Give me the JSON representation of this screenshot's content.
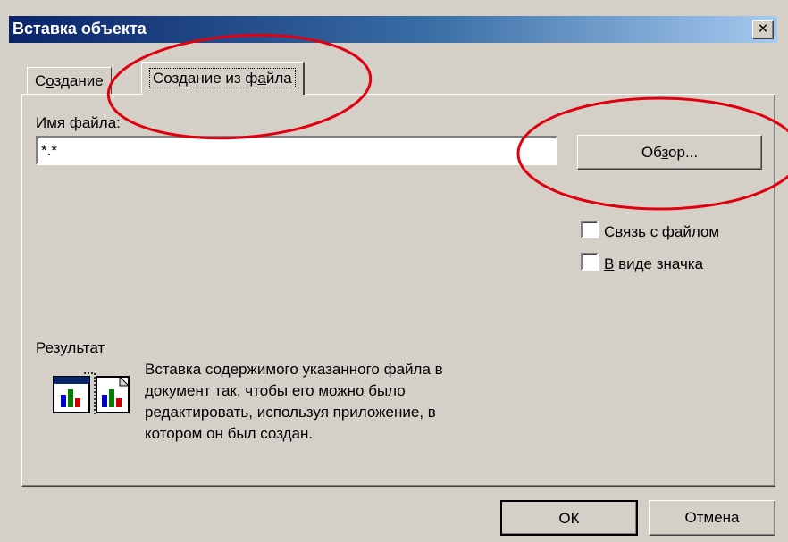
{
  "window": {
    "title": "Вставка объекта",
    "close_label": "✕"
  },
  "tabs": [
    {
      "label_pre": "С",
      "label_u": "о",
      "label_post": "здание"
    },
    {
      "label_pre": "Создание из ф",
      "label_u": "а",
      "label_post": "йла"
    }
  ],
  "filename": {
    "label_pre": "",
    "label_u": "И",
    "label_post": "мя файла:",
    "value": "*.*"
  },
  "browse": {
    "label_pre": "Об",
    "label_u": "з",
    "label_post": "ор..."
  },
  "options": {
    "link": {
      "label_pre": "Свя",
      "label_u": "з",
      "label_post": "ь с файлом",
      "checked": false
    },
    "as_icon": {
      "label_pre": "",
      "label_u": "В",
      "label_post": " виде значка",
      "checked": false
    }
  },
  "result": {
    "label": "Результат",
    "lines": [
      "Вставка содержимого указанного файла в",
      "документ так, чтобы его можно было",
      "редактировать, используя приложение, в",
      "котором он был создан."
    ]
  },
  "buttons": {
    "ok": "ОК",
    "cancel": "Отмена"
  },
  "colors": {
    "annotation": "#e0000f",
    "face": "#d4d0c8",
    "title_start": "#0a246a"
  }
}
